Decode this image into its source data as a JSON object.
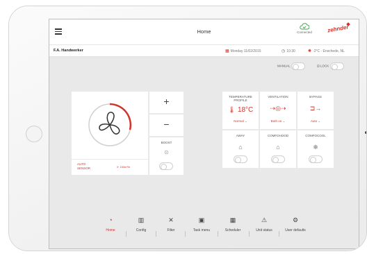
{
  "header": {
    "title": "Home",
    "connection_label": "Connected",
    "brand": "zehnder"
  },
  "infobar": {
    "user": "F.A. Handwerker",
    "date": "Monday 11/02/2015",
    "time": "10:30",
    "weather": "-2°C - Enschede, NL"
  },
  "toggles": {
    "manual_label": "MANUAL",
    "lock_label": "LOCK"
  },
  "fan": {
    "sensor_label_line1": "AUTO",
    "sensor_label_line2": "SENSOR",
    "airflow_value": "153m³/h"
  },
  "controls": {
    "plus": "+",
    "minus": "−",
    "boost_label": "BOOST"
  },
  "status": {
    "temperature": {
      "title_line1": "TEMPERATURE",
      "title_line2": "PROFILE",
      "value": "18°C",
      "selection": "Normal"
    },
    "ventilation": {
      "title": "VENTILATION",
      "selection": "Both on"
    },
    "bypass": {
      "title": "BYPASS",
      "selection": "Auto"
    },
    "away": {
      "title": "AWAY"
    },
    "comfohood": {
      "title": "COMFOHOOD"
    },
    "comfocool": {
      "title": "COMFOCOOL"
    }
  },
  "nav": {
    "items": [
      {
        "label": "Home",
        "icon": "gauge-icon"
      },
      {
        "label": "Config",
        "icon": "config-icon"
      },
      {
        "label": "Filter",
        "icon": "tools-icon"
      },
      {
        "label": "Task menu",
        "icon": "clipboard-icon"
      },
      {
        "label": "Scheduler",
        "icon": "calendar-icon"
      },
      {
        "label": "Unit status",
        "icon": "warning-icon"
      },
      {
        "label": "User defaults",
        "icon": "gear-icon"
      }
    ]
  },
  "colors": {
    "accent": "#d3322b",
    "connected": "#3ea84b",
    "background": "#e9e9e9"
  }
}
